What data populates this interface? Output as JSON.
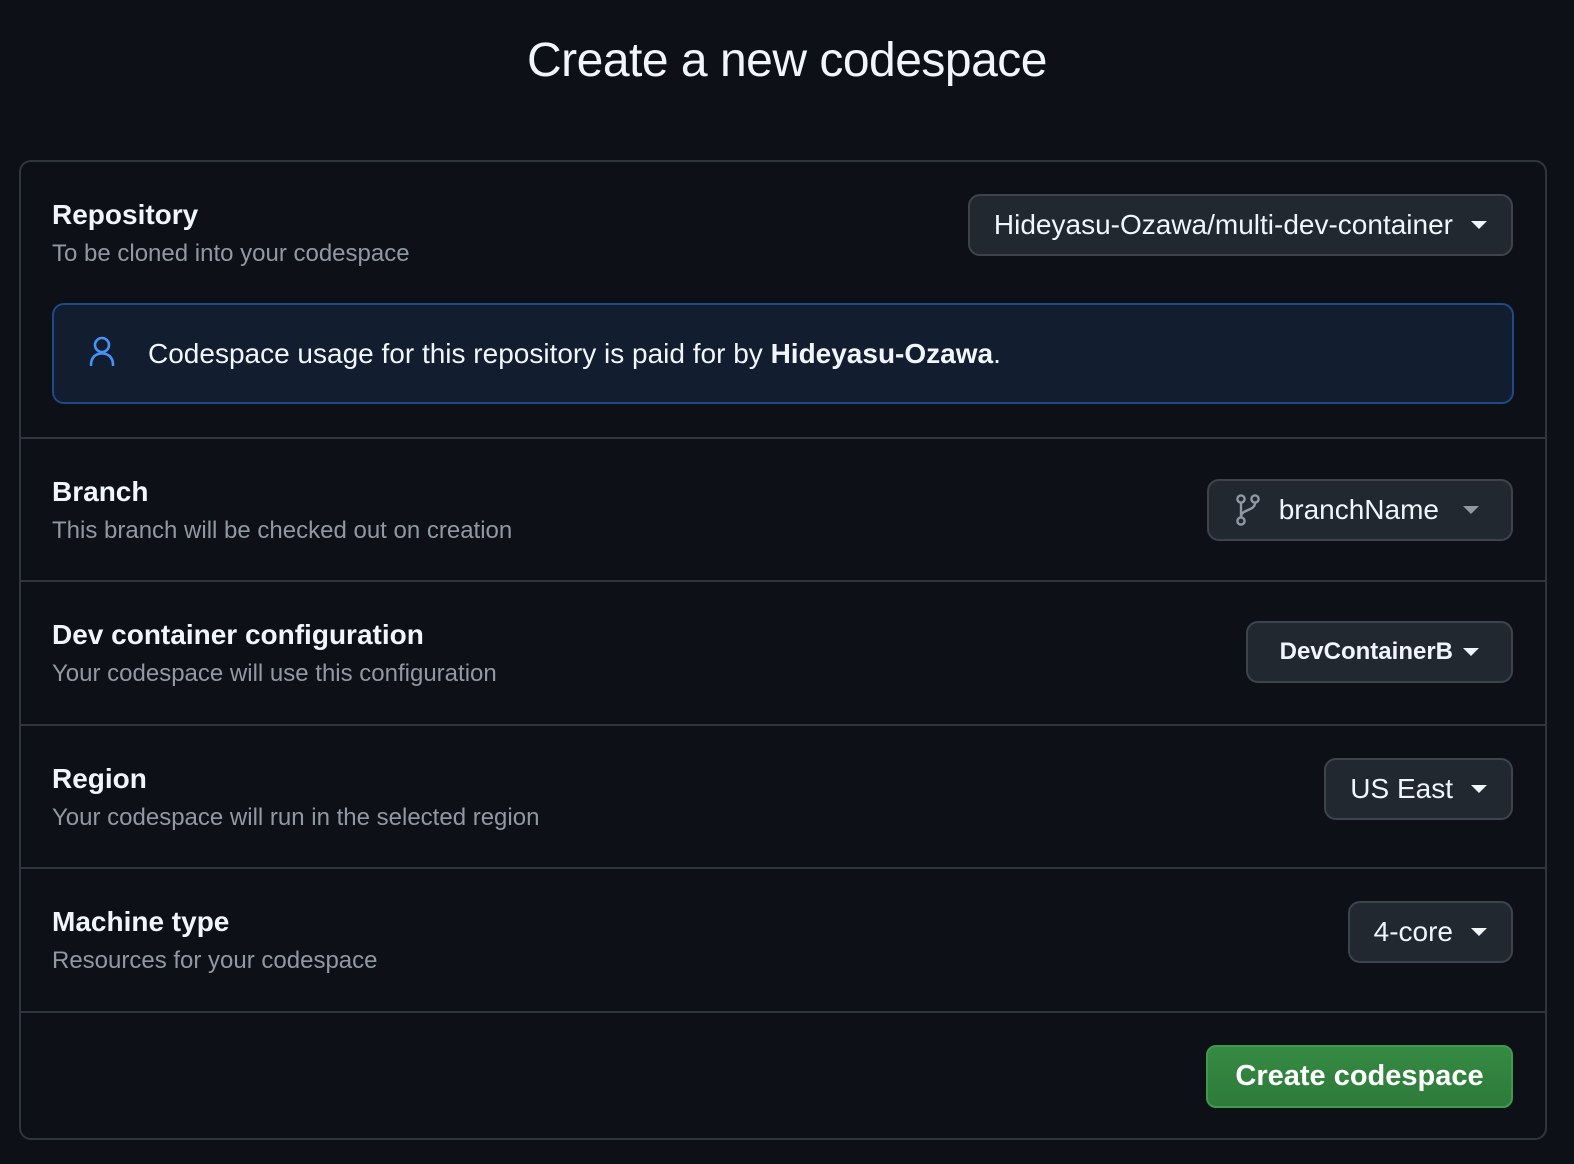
{
  "page": {
    "title": "Create a new codespace"
  },
  "repository": {
    "title": "Repository",
    "description": "To be cloned into your codespace",
    "selected": "Hideyasu-Ozawa/multi-dev-container",
    "notice_prefix": "Codespace usage for this repository is paid for by ",
    "notice_owner": "Hideyasu-Ozawa",
    "notice_suffix": ".",
    "notice_icon": "person-icon"
  },
  "branch": {
    "title": "Branch",
    "description": "This branch will be checked out on creation",
    "selected": "branchName",
    "icon": "git-branch-icon"
  },
  "devcontainer": {
    "title": "Dev container configuration",
    "description": "Your codespace will use this configuration",
    "selected": "DevContainerB"
  },
  "region": {
    "title": "Region",
    "description": "Your codespace will run in the selected region",
    "selected": "US East"
  },
  "machine": {
    "title": "Machine type",
    "description": "Resources for your codespace",
    "selected": "4-core"
  },
  "actions": {
    "create_label": "Create codespace"
  },
  "colors": {
    "background": "#0d1117",
    "border": "#30363d",
    "accent_blue": "#4493f8",
    "create_button": "#2f7d3b"
  }
}
